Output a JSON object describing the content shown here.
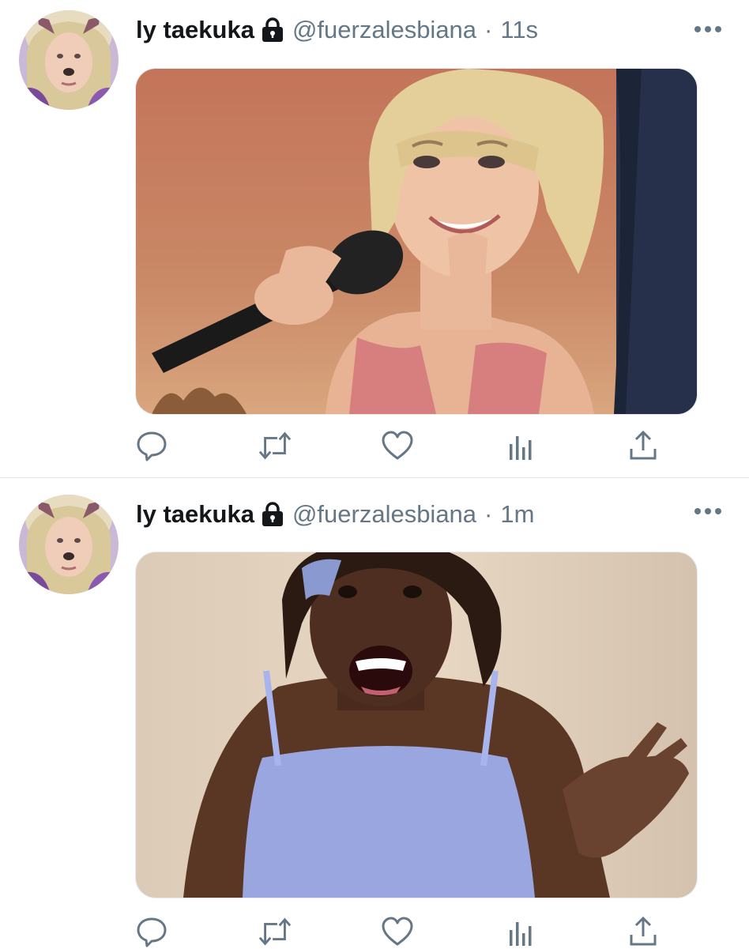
{
  "tweets": [
    {
      "display_name": "ly taekuka",
      "handle": "@fuerzalesbiana",
      "separator": "·",
      "time": "11s"
    },
    {
      "display_name": "ly taekuka",
      "handle": "@fuerzalesbiana",
      "separator": "·",
      "time": "1m"
    }
  ],
  "icons": [
    "lock-icon",
    "more-icon",
    "reply-icon",
    "retweet-icon",
    "like-icon",
    "analytics-icon",
    "share-icon"
  ],
  "colors": {
    "name": "#14171a",
    "secondary": "#657786",
    "divider": "#e1e8ed"
  }
}
